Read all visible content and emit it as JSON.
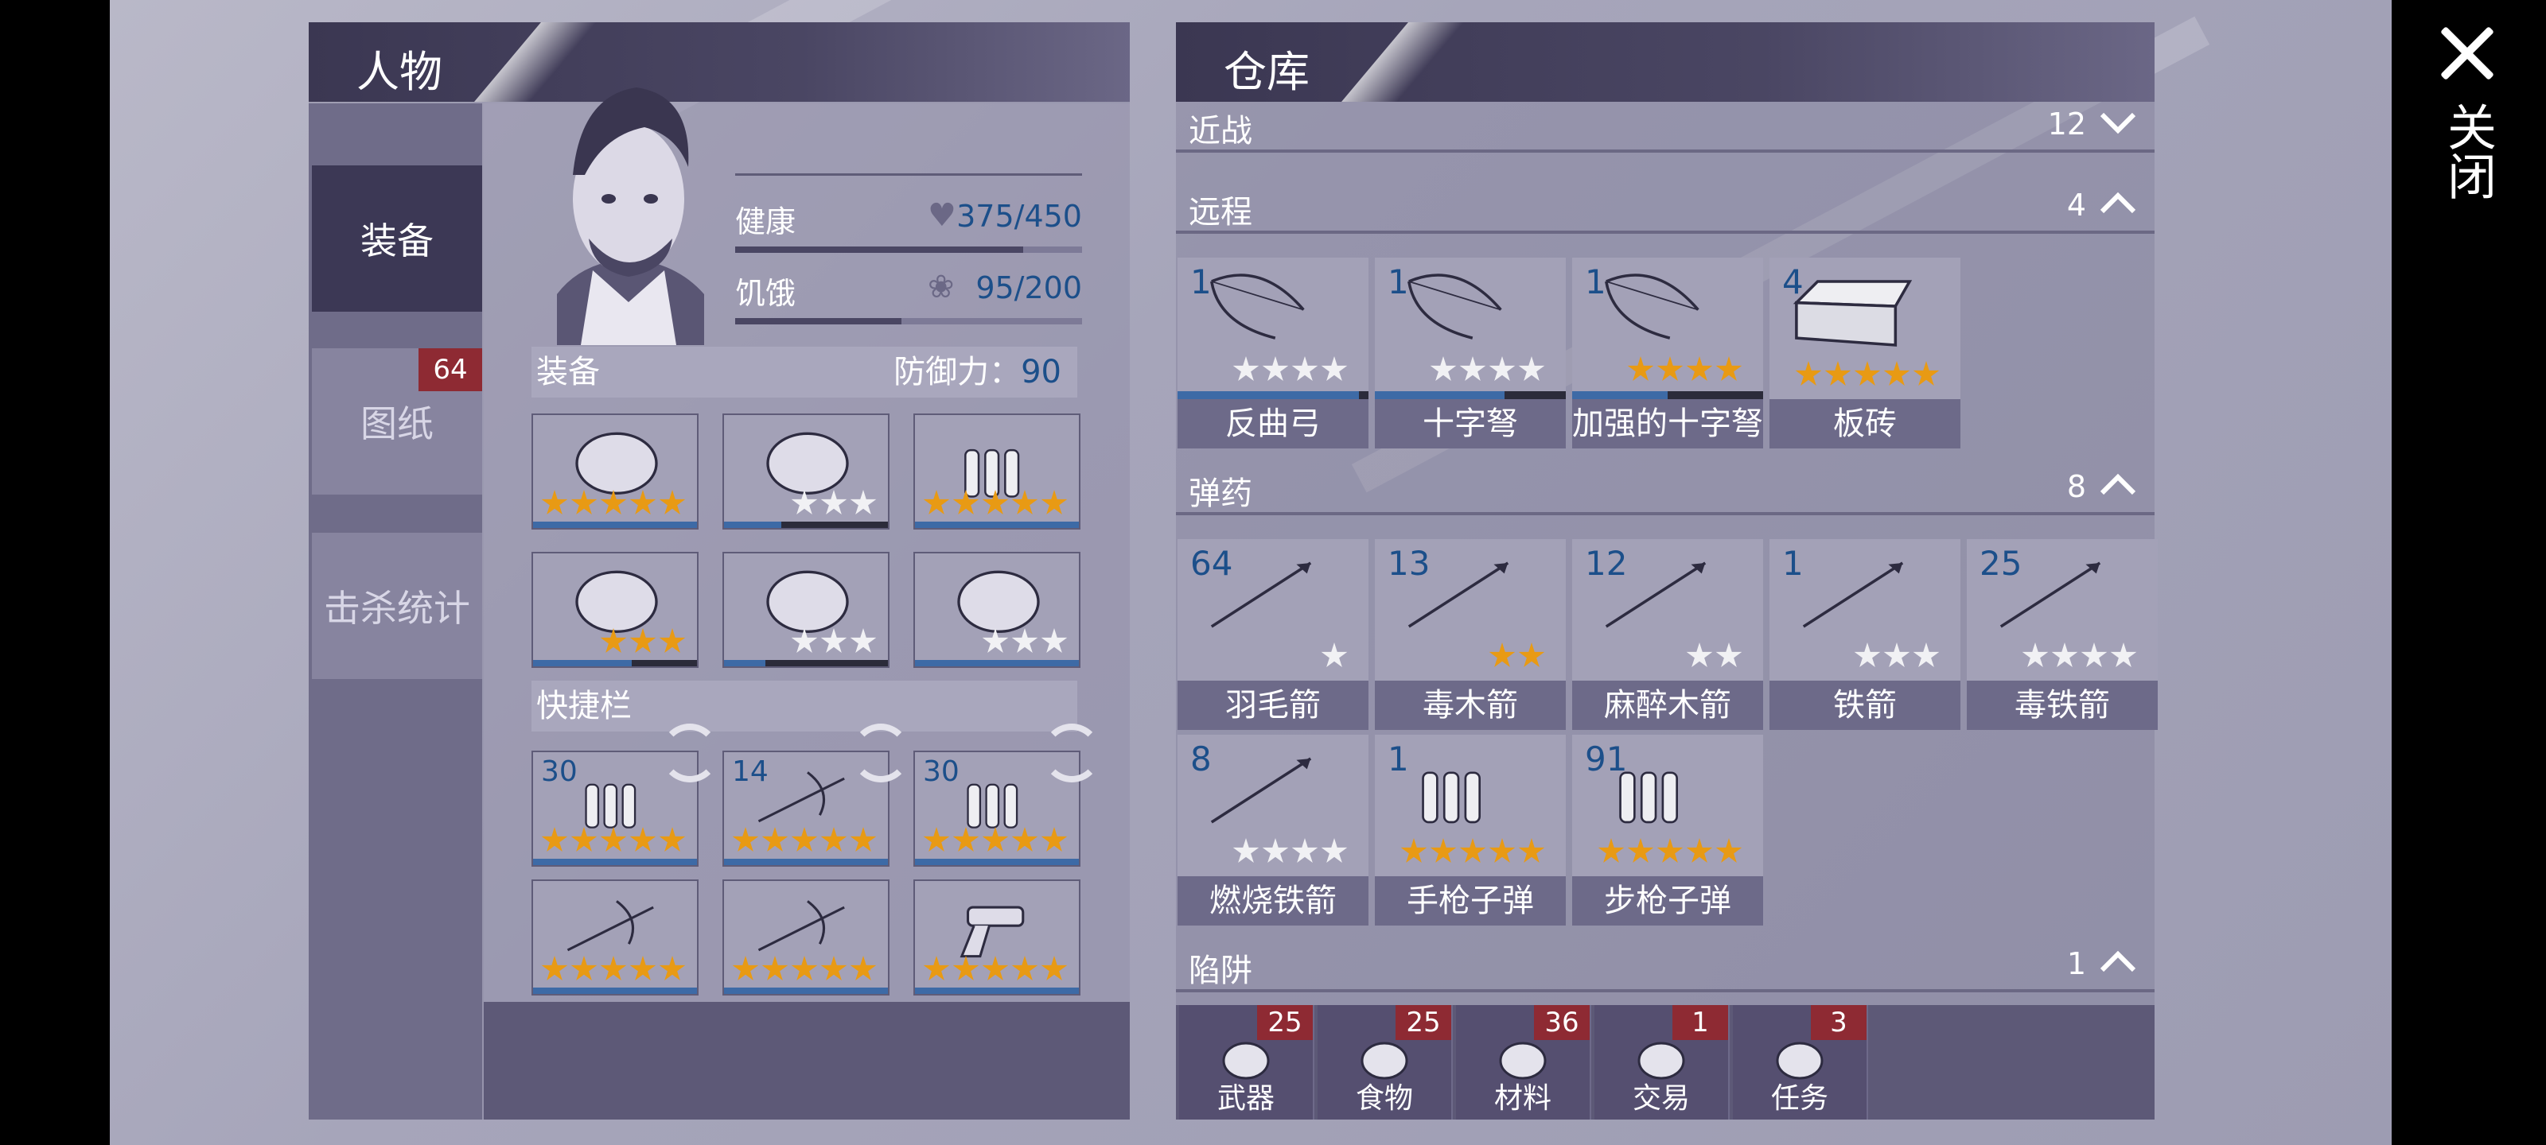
{
  "character_panel": {
    "title": "人物",
    "tabs": [
      {
        "label": "装备",
        "active": true
      },
      {
        "label": "图纸",
        "badge": "64"
      },
      {
        "label": "击杀统计"
      }
    ],
    "health": {
      "label": "健康",
      "value": "375/450",
      "fraction": 0.83
    },
    "hunger": {
      "label": "饥饿",
      "value": "95/200",
      "fraction": 0.48
    },
    "equipment_title": "装备",
    "defense_label": "防御力：",
    "defense_value": "90",
    "quickbar_title": "快捷栏",
    "equipment": [
      {
        "icon": "chicken-mask-icon",
        "stars": 5,
        "gold": 5,
        "durability": 1.0
      },
      {
        "icon": "hoodie-icon",
        "stars": 3,
        "gold": 0,
        "durability": 0.35
      },
      {
        "icon": "turtle-shell-icon",
        "stars": 5,
        "gold": 5,
        "durability": 1.0
      },
      {
        "icon": "gloves-icon",
        "stars": 3,
        "gold": 3,
        "durability": 0.6
      },
      {
        "icon": "shorts-icon",
        "stars": 3,
        "gold": 0,
        "durability": 0.25
      },
      {
        "icon": "sneakers-icon",
        "stars": 3,
        "gold": 0,
        "durability": 1.0
      }
    ],
    "quickbar": [
      {
        "count": "30",
        "icon": "rifle-ammo-icon",
        "stars": 5
      },
      {
        "count": "14",
        "icon": "shotgun-shell-icon",
        "stars": 5
      },
      {
        "count": "30",
        "icon": "pistol-ammo-icon",
        "stars": 5
      },
      {
        "icon": "rifle-icon",
        "stars": 5
      },
      {
        "icon": "shotgun-icon",
        "stars": 5
      },
      {
        "icon": "revolver-icon",
        "stars": 5
      }
    ]
  },
  "warehouse": {
    "title": "仓库",
    "categories": {
      "melee": {
        "name": "近战",
        "count": "12",
        "expanded": false
      },
      "ranged": {
        "name": "远程",
        "count": "4",
        "expanded": true
      },
      "ammo": {
        "name": "弹药",
        "count": "8",
        "expanded": true
      },
      "traps": {
        "name": "陷阱",
        "count": "1",
        "expanded": true
      }
    },
    "ranged_items": [
      {
        "count": "1",
        "label": "反曲弓",
        "icon": "recurve-bow-icon",
        "stars": 4,
        "gold": 0,
        "durability": 0.95
      },
      {
        "count": "1",
        "label": "十字弩",
        "icon": "crossbow-icon",
        "stars": 4,
        "gold": 0,
        "durability": 0.68
      },
      {
        "count": "1",
        "label": "加强的十字弩",
        "icon": "crossbow-icon",
        "stars": 4,
        "gold": 4,
        "durability": 0.5
      },
      {
        "count": "4",
        "label": "板砖",
        "icon": "brick-icon",
        "stars": 5,
        "gold": 5
      }
    ],
    "ammo_items": [
      {
        "count": "64",
        "label": "羽毛箭",
        "icon": "feather-arrow-icon",
        "stars": 1,
        "gold": 0
      },
      {
        "count": "13",
        "label": "毒木箭",
        "icon": "poison-arrow-icon",
        "stars": 2,
        "gold": 2
      },
      {
        "count": "12",
        "label": "麻醉木箭",
        "icon": "tranq-arrow-icon",
        "stars": 2,
        "gold": 0
      },
      {
        "count": "1",
        "label": "铁箭",
        "icon": "iron-arrow-icon",
        "stars": 3,
        "gold": 0
      },
      {
        "count": "25",
        "label": "毒铁箭",
        "icon": "poison-iron-arrow-icon",
        "stars": 4,
        "gold": 0
      },
      {
        "count": "8",
        "label": "燃烧铁箭",
        "icon": "fire-arrow-icon",
        "stars": 4,
        "gold": 0
      },
      {
        "count": "1",
        "label": "手枪子弹",
        "icon": "pistol-ammo-icon",
        "stars": 5,
        "gold": 5
      },
      {
        "count": "91",
        "label": "步枪子弹",
        "icon": "rifle-ammo-icon",
        "stars": 5,
        "gold": 5
      }
    ],
    "footer_tabs": [
      {
        "label": "武器",
        "badge": "25",
        "icon": "axe-icon"
      },
      {
        "label": "食物",
        "badge": "25",
        "icon": "meat-icon"
      },
      {
        "label": "材料",
        "badge": "36",
        "icon": "log-icon"
      },
      {
        "label": "交易",
        "badge": "1",
        "icon": "coin-icon"
      },
      {
        "label": "任务",
        "badge": "3",
        "icon": "key-icon"
      }
    ]
  },
  "close_label": "关闭",
  "colors": {
    "accent_blue": "#1c4f8a",
    "star_gold": "#e89a14",
    "badge_red": "#8e2a33"
  }
}
